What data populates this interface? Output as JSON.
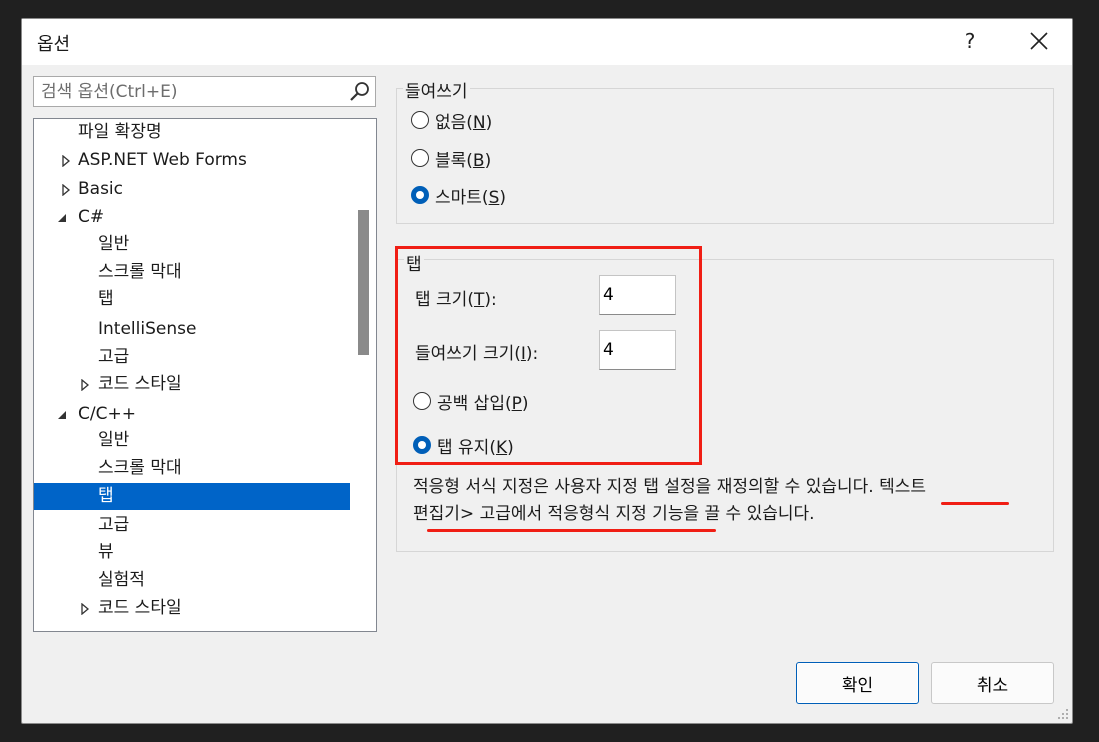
{
  "window": {
    "title": "옵션",
    "help": "?"
  },
  "search": {
    "placeholder": "검색 옵션(Ctrl+E)"
  },
  "tree": [
    {
      "label": "파일 확장명",
      "arrow": "none"
    },
    {
      "label": "ASP.NET Web Forms",
      "arrow": "collapsed"
    },
    {
      "label": "Basic",
      "arrow": "collapsed"
    },
    {
      "label": "C#",
      "arrow": "expanded"
    },
    {
      "label": "일반",
      "arrow": "none"
    },
    {
      "label": "스크롤 막대",
      "arrow": "none"
    },
    {
      "label": "탭",
      "arrow": "none"
    },
    {
      "label": "IntelliSense",
      "arrow": "none"
    },
    {
      "label": "고급",
      "arrow": "none"
    },
    {
      "label": "코드 스타일",
      "arrow": "collapsed"
    },
    {
      "label": "C/C++",
      "arrow": "expanded"
    },
    {
      "label": "일반",
      "arrow": "none"
    },
    {
      "label": "스크롤 막대",
      "arrow": "none"
    },
    {
      "label": "탭",
      "arrow": "none",
      "selected": true
    },
    {
      "label": "고급",
      "arrow": "none"
    },
    {
      "label": "뷰",
      "arrow": "none"
    },
    {
      "label": "실험적",
      "arrow": "none"
    },
    {
      "label": "코드 스타일",
      "arrow": "collapsed"
    }
  ],
  "indent": {
    "title": "들여쓰기",
    "none_label": "없음(",
    "none_key": "N",
    "block_label": "블록(",
    "block_key": "B",
    "smart_label": "스마트(",
    "smart_key": "S",
    "close_paren": ")",
    "selected": "smart"
  },
  "tabs": {
    "title": "탭",
    "tab_size_label": "탭 크기(",
    "tab_size_key": "T",
    "tab_size_suffix": "):",
    "tab_size_value": "4",
    "indent_size_label": "들여쓰기 크기(",
    "indent_size_key": "I",
    "indent_size_suffix": "):",
    "indent_size_value": "4",
    "insert_spaces_label": "공백 삽입(",
    "insert_spaces_key": "P",
    "keep_tabs_label": "탭 유지(",
    "keep_tabs_key": "K",
    "close_paren": ")",
    "selected": "keep_tabs"
  },
  "note": {
    "line1": "적응형 서식 지정은 사용자 지정 탭 설정을 재정의할 수 있습니다. 텍스트",
    "line2": "편집기> 고급에서 적응형식 지정 기능을 끌 수 있습니다."
  },
  "buttons": {
    "ok": "확인",
    "cancel": "취소"
  },
  "colors": {
    "selection": "#0064c8",
    "accent": "#005fb8",
    "annotation": "#f01e14"
  }
}
